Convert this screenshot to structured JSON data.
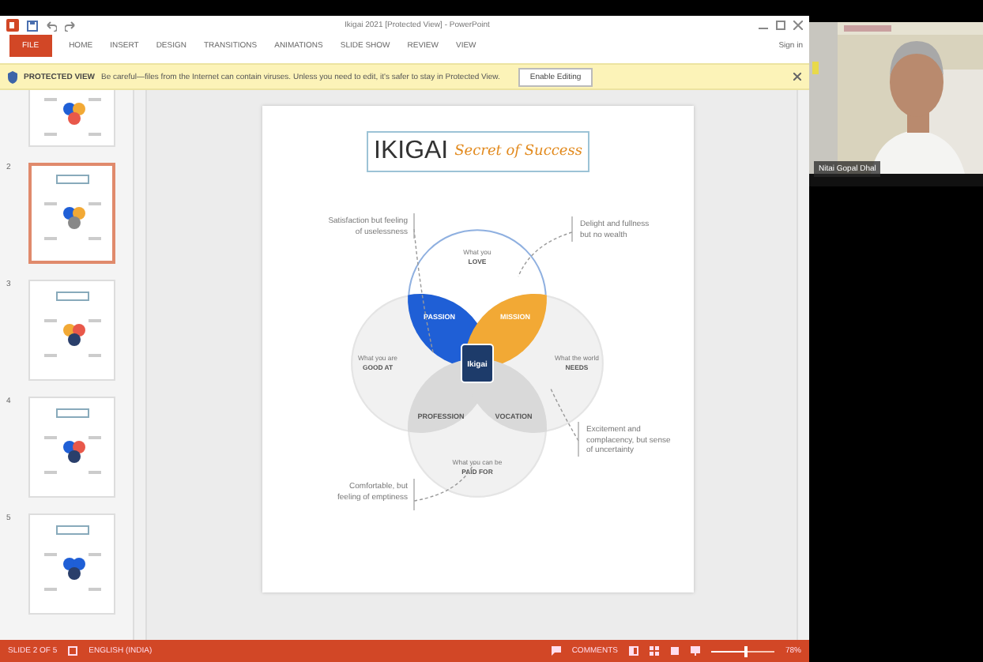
{
  "app": {
    "title": "Ikigai 2021 [Protected View] - PowerPoint",
    "sign_in": "Sign in"
  },
  "ribbon_tabs": [
    {
      "label": "FILE",
      "kind": "file",
      "selected": false
    },
    {
      "label": "HOME",
      "kind": "tab",
      "selected": false
    },
    {
      "label": "INSERT",
      "kind": "tab",
      "selected": false
    },
    {
      "label": "DESIGN",
      "kind": "tab",
      "selected": false
    },
    {
      "label": "TRANSITIONS",
      "kind": "tab",
      "selected": false
    },
    {
      "label": "ANIMATIONS",
      "kind": "tab",
      "selected": false
    },
    {
      "label": "SLIDE SHOW",
      "kind": "tab",
      "selected": false
    },
    {
      "label": "REVIEW",
      "kind": "tab",
      "selected": false
    },
    {
      "label": "VIEW",
      "kind": "tab",
      "selected": false
    }
  ],
  "protected_view": {
    "label": "PROTECTED VIEW",
    "message": "Be careful—files from the Internet can contain viruses. Unless you need to edit, it's safer to stay in Protected View.",
    "button": "Enable Editing"
  },
  "thumbnails": [
    {
      "selected": false
    },
    {
      "number": "2",
      "selected": true
    },
    {
      "number": "3",
      "selected": false
    },
    {
      "number": "4",
      "selected": false
    },
    {
      "number": "5",
      "selected": false
    }
  ],
  "slide": {
    "title": "IKIGAI",
    "subtitle": "Secret of Success",
    "circles": [
      {
        "text": "What you",
        "label": "LOVE"
      },
      {
        "text": "What you are",
        "label": "GOOD AT"
      },
      {
        "text": "What the world",
        "label": "NEEDS"
      },
      {
        "text": "What you can be",
        "label": "PAID FOR"
      }
    ],
    "overlaps": [
      {
        "label": "PASSION",
        "color": "#1f5fd6"
      },
      {
        "label": "MISSION",
        "color": "#f2a935"
      },
      {
        "label": "PROFESSION",
        "color": "#d9d9d9"
      },
      {
        "label": "VOCATION",
        "color": "#d9d9d9"
      }
    ],
    "center": "Ikigai",
    "notes": [
      "Satisfaction but feeling of uselessness",
      "Delight and fullness but no wealth",
      "Excitement and complacency, but sense of uncertainty",
      "Comfortable, but feeling of emptiness"
    ]
  },
  "status_bar": {
    "slide": "SLIDE 2 OF 5",
    "language": "ENGLISH (INDIA)",
    "comments": "COMMENTS",
    "zoom": {
      "level": 0.55,
      "reading": "78%"
    }
  },
  "video": {
    "name": "Nitai Gopal Dhal"
  }
}
